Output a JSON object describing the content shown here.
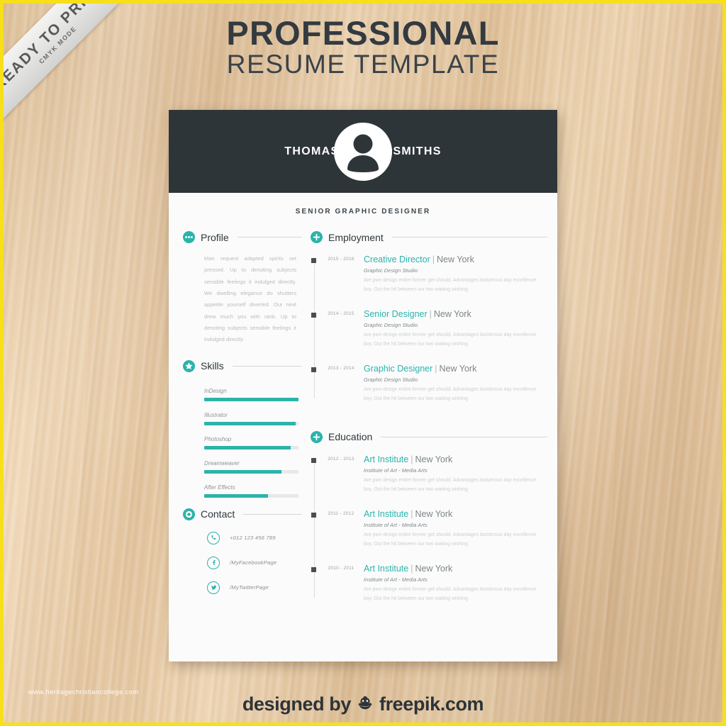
{
  "ribbon": {
    "main": "READY TO PRINT",
    "sub": "CMYK MODE"
  },
  "top_title": {
    "line1": "PROFESSIONAL",
    "line2": "RESUME TEMPLATE"
  },
  "header": {
    "first_name": "THOMAS",
    "last_name": "SMITHS",
    "job_title": "SENIOR GRAPHIC DESIGNER",
    "avatar_icon": "user-avatar-icon",
    "background_color": "#2e3539"
  },
  "accent_color": "#2bb3ab",
  "profile": {
    "heading": "Profile",
    "icon": "ellipsis-bubble-icon",
    "text": "Man request adapted spirits set pressed. Up to denoting subjects sensible feelings it indulged directly. We dwelling elegance do shutters appetite yourself diverted. Our next drew much you with rank. Up to denoting subjects sensible feelings it indulged directly."
  },
  "skills": {
    "heading": "Skills",
    "icon": "star-badge-icon",
    "items": [
      {
        "name": "InDesign",
        "level": 100
      },
      {
        "name": "Illustrator",
        "level": 97
      },
      {
        "name": "Photoshop",
        "level": 92
      },
      {
        "name": "Dreamweaver",
        "level": 82
      },
      {
        "name": "After Effects",
        "level": 68
      }
    ]
  },
  "contact": {
    "heading": "Contact",
    "icon": "chat-circle-icon",
    "items": [
      {
        "icon": "phone-icon",
        "value": "+012 123 456 789"
      },
      {
        "icon": "facebook-icon",
        "value": "/MyFacebookPage"
      },
      {
        "icon": "twitter-icon",
        "value": "/MyTwitterPage"
      }
    ]
  },
  "employment": {
    "heading": "Employment",
    "icon": "plus-circle-icon",
    "entries": [
      {
        "dates": "2015 - 2016",
        "title": "Creative Director",
        "separator": "|",
        "location": "New York",
        "subtitle": "Graphic Design Studio",
        "description": "Are pwn design entire former get should. Advantages boisterous day excellence boy. Out the hit between our two waiting wishing"
      },
      {
        "dates": "2014 - 2015",
        "title": "Senior Designer",
        "separator": "|",
        "location": "New York",
        "subtitle": "Graphic Design Studio",
        "description": "Are pwn design entire former get should. Advantages boisterous day excellence boy. Out the hit between our two waiting wishing"
      },
      {
        "dates": "2013 - 2014",
        "title": "Graphic Designer",
        "separator": "|",
        "location": "New York",
        "subtitle": "Graphic Design Studio",
        "description": "Are pwn design entire former get should. Advantages boisterous day excellence boy. Out the hit between our two waiting wishing"
      }
    ]
  },
  "education": {
    "heading": "Education",
    "icon": "plus-circle-icon",
    "entries": [
      {
        "dates": "2012 - 2013",
        "title": "Art Institute",
        "separator": "|",
        "location": "New York",
        "subtitle": "Institute of Art - Media Arts",
        "description": "Are pwn design entire former get should. Advantages boisterous day excellence boy. Out the hit between our two waiting wishing"
      },
      {
        "dates": "2011 - 2012",
        "title": "Art Institute",
        "separator": "|",
        "location": "New York",
        "subtitle": "Institute of Art - Media Arts",
        "description": "Are pwn design entire former get should. Advantages boisterous day excellence boy. Out the hit between our two waiting wishing"
      },
      {
        "dates": "2010 - 2011",
        "title": "Art Institute",
        "separator": "|",
        "location": "New York",
        "subtitle": "Institute of Art - Media Arts",
        "description": "Are pwn design entire former get should. Advantages boisterous day excellence boy. Out the hit between our two waiting wishing"
      }
    ]
  },
  "watermark": "www.heritagechristiancollege.com",
  "footer": {
    "prefix": "designed by",
    "brand": "freepik.com",
    "logo_icon": "freepik-logo-icon"
  }
}
